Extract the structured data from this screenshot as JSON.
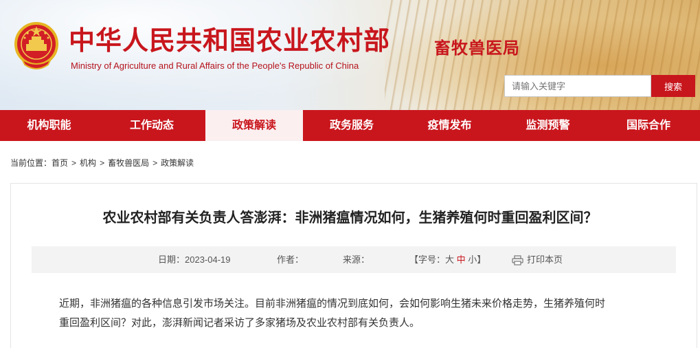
{
  "header": {
    "site_title": "中华人民共和国农业农村部",
    "site_subtitle": "Ministry of Agriculture and Rural Affairs of the People's Republic of China",
    "dept_title": "畜牧兽医局",
    "emblem_icon": "national-emblem-icon",
    "search": {
      "placeholder": "请输入关键字",
      "button_label": "搜索"
    },
    "colors": {
      "brand_red": "#c8161d",
      "nav_red": "#c9161d"
    }
  },
  "nav": {
    "items": [
      {
        "label": "机构职能",
        "active": false
      },
      {
        "label": "工作动态",
        "active": false
      },
      {
        "label": "政策解读",
        "active": true
      },
      {
        "label": "政务服务",
        "active": false
      },
      {
        "label": "疫情发布",
        "active": false
      },
      {
        "label": "监测预警",
        "active": false
      },
      {
        "label": "国际合作",
        "active": false
      }
    ]
  },
  "breadcrumb": {
    "prefix": "当前位置：",
    "items": [
      "首页",
      "机构",
      "畜牧兽医局",
      "政策解读"
    ],
    "separator": ">"
  },
  "article": {
    "title": "农业农村部有关负责人答澎湃：非洲猪瘟情况如何，生猪养殖何时重回盈利区间？",
    "meta": {
      "date_label": "日期：2023-04-19",
      "author_label": "作者：",
      "source_label": "来源：",
      "font_size_prefix": "【字号：",
      "font_size_large": "大",
      "font_size_medium": "中",
      "font_size_small": "小",
      "font_size_suffix": "】",
      "print_label": "打印本页",
      "print_icon": "printer-icon"
    },
    "paragraph_line1": "近期，非洲猪瘟的各种信息引发市场关注。目前非洲猪瘟的情况到底如何，会如何影响生猪未来价格走势，生猪养殖何时",
    "paragraph_line2": "重回盈利区间？对此，澎湃新闻记者采访了多家猪场及农业农村部有关负责人。"
  }
}
